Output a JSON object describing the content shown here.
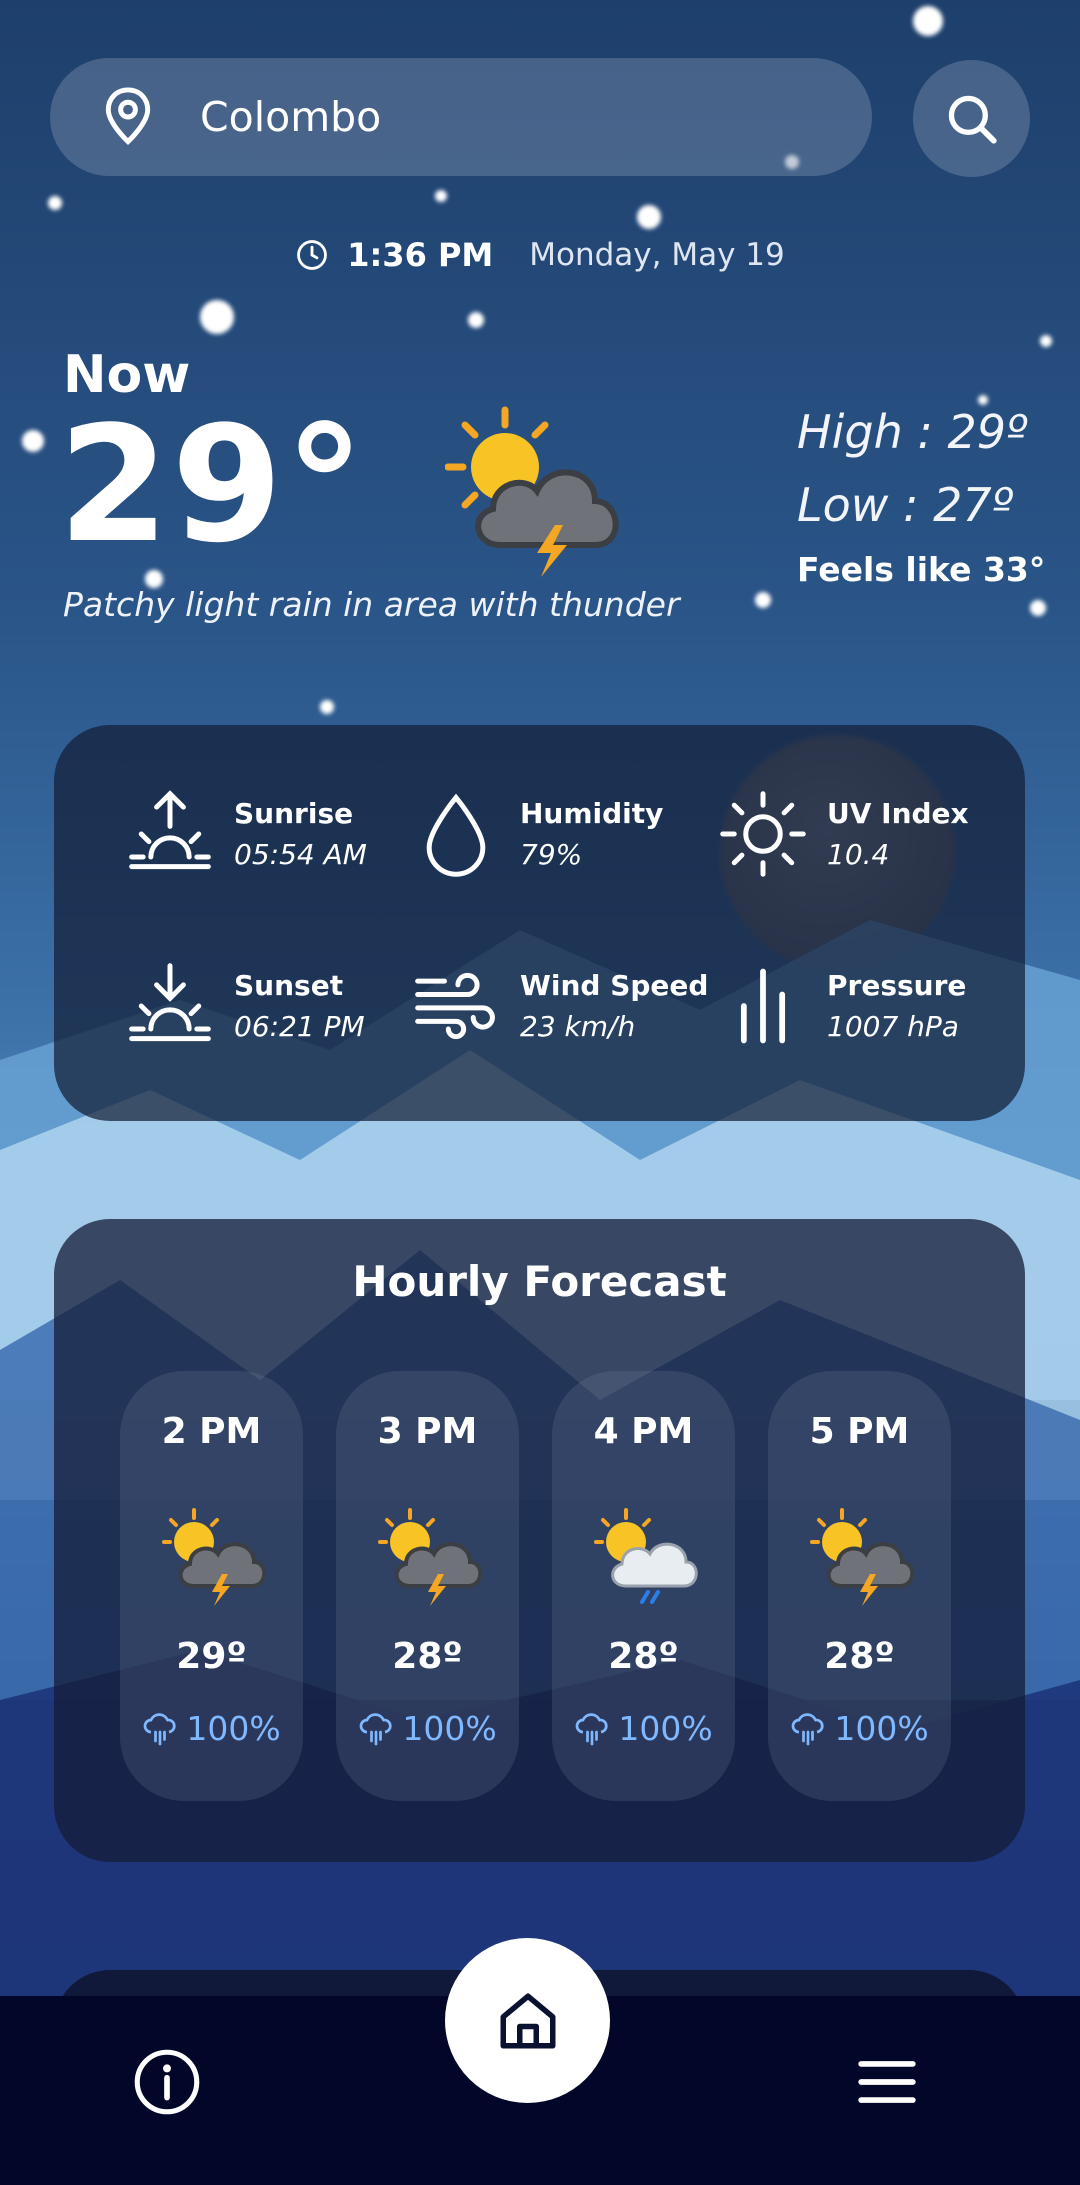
{
  "search": {
    "city": "Colombo",
    "icons": {
      "location": "location-pin-icon",
      "search": "search-icon"
    }
  },
  "timebar": {
    "time": "1:36 PM",
    "date": "Monday, May 19"
  },
  "current": {
    "label": "Now",
    "temperature": "29°",
    "condition": "Patchy light rain in area with thunder",
    "icon": "sun-cloud-thunder-icon",
    "high": "High : 29º",
    "low": "Low : 27º",
    "feels_like": "Feels like 33°"
  },
  "details": [
    {
      "label": "Sunrise",
      "value": "05:54 AM",
      "icon": "sunrise-icon"
    },
    {
      "label": "Humidity",
      "value": "79%",
      "icon": "humidity-drop-icon"
    },
    {
      "label": "UV Index",
      "value": "10.4",
      "icon": "sun-icon"
    },
    {
      "label": "Sunset",
      "value": "06:21 PM",
      "icon": "sunset-icon"
    },
    {
      "label": "Wind Speed",
      "value": "23 km/h",
      "icon": "wind-icon"
    },
    {
      "label": "Pressure",
      "value": "1007 hPa",
      "icon": "pressure-bars-icon"
    }
  ],
  "hourly": {
    "title": "Hourly Forecast",
    "items": [
      {
        "time": "2 PM",
        "temp": "29º",
        "chance": "100%",
        "icon": "sun-cloud-thunder-icon"
      },
      {
        "time": "3 PM",
        "temp": "28º",
        "chance": "100%",
        "icon": "sun-cloud-thunder-icon"
      },
      {
        "time": "4 PM",
        "temp": "28º",
        "chance": "100%",
        "icon": "sun-cloud-rain-icon"
      },
      {
        "time": "5 PM",
        "temp": "28º",
        "chance": "100%",
        "icon": "sun-cloud-thunder-icon"
      }
    ]
  },
  "nav": {
    "left": "info-icon",
    "center": "home-icon",
    "right": "menu-icon"
  },
  "colors": {
    "rain_chance": "#7fb8ff",
    "nav_bg": "#02072a",
    "card_bg": "#141e37"
  }
}
